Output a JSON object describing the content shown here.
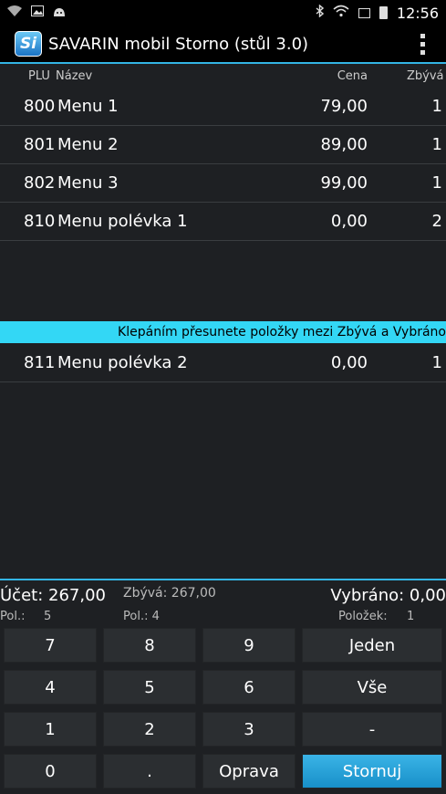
{
  "status_bar": {
    "time": "12:56",
    "icons": [
      "wifi-question-icon",
      "image-icon",
      "android-icon",
      "bluetooth-icon",
      "wifi-icon",
      "alert-icon",
      "battery-icon"
    ]
  },
  "app": {
    "logo_text": "Si",
    "title": "SAVARIN mobil Storno (stůl 3.0)"
  },
  "columns": {
    "plu": "PLU",
    "name": "Název",
    "price": "Cena",
    "remaining": "Zbývá"
  },
  "remaining_items": [
    {
      "plu": "800",
      "name": "Menu 1",
      "price": "79,00",
      "qty": "1"
    },
    {
      "plu": "801",
      "name": "Menu 2",
      "price": "89,00",
      "qty": "1"
    },
    {
      "plu": "802",
      "name": "Menu 3",
      "price": "99,00",
      "qty": "1"
    },
    {
      "plu": "810",
      "name": "Menu polévka 1",
      "price": "0,00",
      "qty": "2"
    }
  ],
  "banner": "Klepáním přesunete položky mezi Zbývá a Vybráno",
  "selected_items": [
    {
      "plu": "811",
      "name": "Menu polévka 2",
      "price": "0,00",
      "qty": "1"
    }
  ],
  "summary": {
    "account": "Účet: 267,00",
    "account_pol_label": "Pol.:",
    "account_pol_value": "5",
    "remaining": "Zbývá: 267,00",
    "remaining_pol": "Pol.:   4",
    "selected": "Vybráno: 0,00",
    "selected_items_label": "Položek:",
    "selected_items_value": "1"
  },
  "keypad": {
    "k7": "7",
    "k8": "8",
    "k9": "9",
    "jeden": "Jeden",
    "k4": "4",
    "k5": "5",
    "k6": "6",
    "vse": "Vše",
    "k1": "1",
    "k2": "2",
    "k3": "3",
    "minus": "-",
    "k0": "0",
    "dot": ".",
    "oprava": "Oprava",
    "stornuj": "Stornuj"
  },
  "colors": {
    "accent": "#33b5e5",
    "banner": "#33d7f5",
    "background": "#1e2023"
  }
}
